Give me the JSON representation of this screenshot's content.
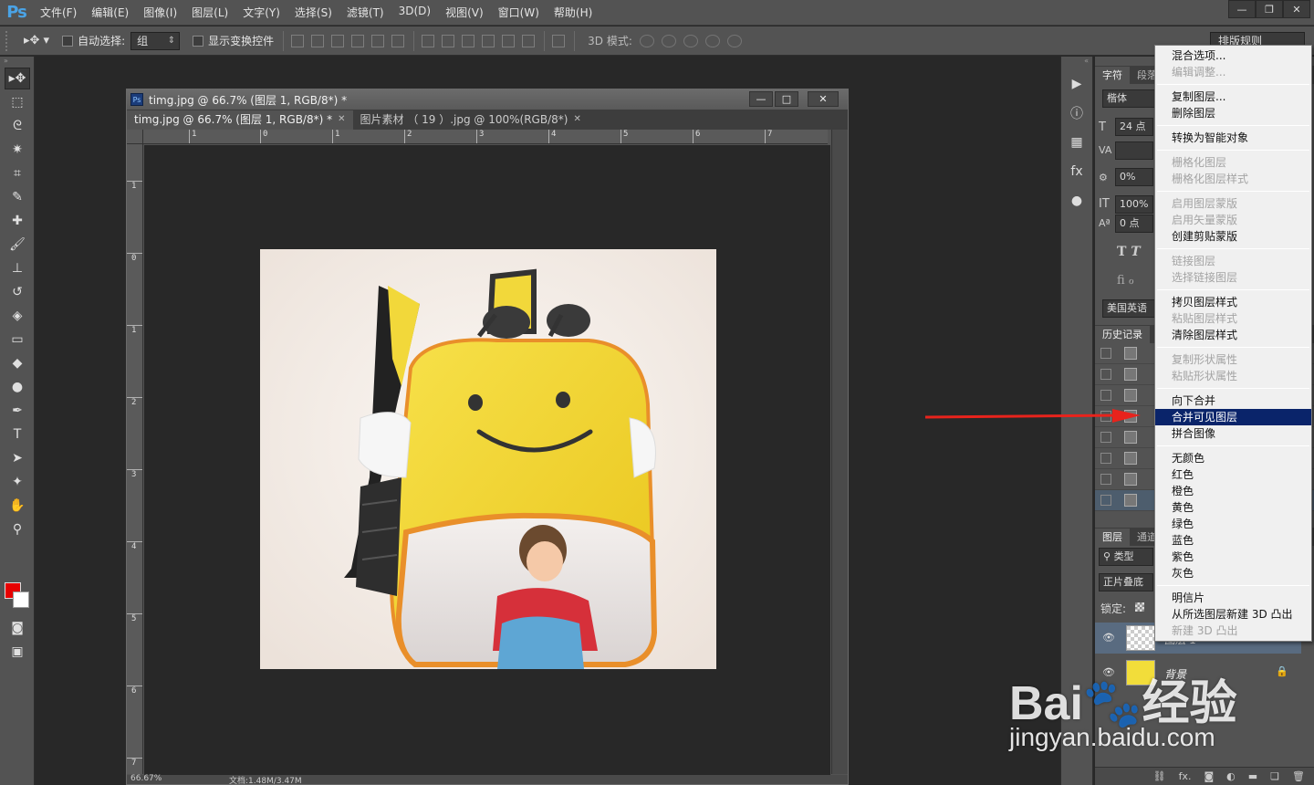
{
  "app": {
    "logo": "Ps",
    "menu": [
      "文件(F)",
      "编辑(E)",
      "图像(I)",
      "图层(L)",
      "文字(Y)",
      "选择(S)",
      "滤镜(T)",
      "3D(D)",
      "视图(V)",
      "窗口(W)",
      "帮助(H)"
    ],
    "window_controls": [
      "—",
      "❐",
      "✕"
    ]
  },
  "options_bar": {
    "auto_select_label": "自动选择:",
    "auto_select_value": "组",
    "show_transform_label": "显示变换控件",
    "mode_3d_label": "3D 模式:",
    "workspace": "排版规则"
  },
  "document": {
    "title": "timg.jpg @ 66.7% (图层 1, RGB/8*) *",
    "tabs": [
      {
        "label": "timg.jpg @ 66.7% (图层 1, RGB/8*) *",
        "close": "✕"
      },
      {
        "label": "图片素材 （ 19 ）.jpg @ 100%(RGB/8*)",
        "close": "✕"
      }
    ],
    "ruler_top": [
      "1",
      "0",
      "1",
      "2",
      "3",
      "4",
      "5",
      "6",
      "7"
    ],
    "ruler_left": [
      "1",
      "0",
      "1",
      "2",
      "3",
      "4",
      "5",
      "6",
      "7"
    ],
    "status_zoom": "66.67%",
    "status_doc": "文档:1.48M/3.47M"
  },
  "right_panel": {
    "char_tabs": [
      "字符",
      "段落"
    ],
    "font_family": "楷体",
    "font_size": "24 点",
    "tracking": "0%",
    "vscale": "100%",
    "baseline": "0 点",
    "language": "美国英语",
    "history_tab": "历史记录",
    "layers_tabs": [
      "图层",
      "通道"
    ],
    "filter_kind": "类型",
    "blend_mode": "正片叠底",
    "lock_label": "锁定:",
    "layers": [
      {
        "name": "图层 1"
      },
      {
        "name": "背景"
      }
    ]
  },
  "context_menu": {
    "groups": [
      [
        {
          "label": "混合选项...",
          "enabled": true
        },
        {
          "label": "编辑调整...",
          "enabled": false
        }
      ],
      [
        {
          "label": "复制图层...",
          "enabled": true
        },
        {
          "label": "删除图层",
          "enabled": true
        }
      ],
      [
        {
          "label": "转换为智能对象",
          "enabled": true
        }
      ],
      [
        {
          "label": "栅格化图层",
          "enabled": false
        },
        {
          "label": "栅格化图层样式",
          "enabled": false
        }
      ],
      [
        {
          "label": "启用图层蒙版",
          "enabled": false
        },
        {
          "label": "启用矢量蒙版",
          "enabled": false
        },
        {
          "label": "创建剪贴蒙版",
          "enabled": true
        }
      ],
      [
        {
          "label": "链接图层",
          "enabled": false
        },
        {
          "label": "选择链接图层",
          "enabled": false
        }
      ],
      [
        {
          "label": "拷贝图层样式",
          "enabled": true
        },
        {
          "label": "粘贴图层样式",
          "enabled": false
        },
        {
          "label": "清除图层样式",
          "enabled": true
        }
      ],
      [
        {
          "label": "复制形状属性",
          "enabled": false
        },
        {
          "label": "粘贴形状属性",
          "enabled": false
        }
      ],
      [
        {
          "label": "向下合并",
          "enabled": true
        },
        {
          "label": "合并可见图层",
          "enabled": true,
          "selected": true
        },
        {
          "label": "拼合图像",
          "enabled": true
        }
      ],
      [
        {
          "label": "无颜色",
          "enabled": true
        },
        {
          "label": "红色",
          "enabled": true
        },
        {
          "label": "橙色",
          "enabled": true
        },
        {
          "label": "黄色",
          "enabled": true
        },
        {
          "label": "绿色",
          "enabled": true
        },
        {
          "label": "蓝色",
          "enabled": true
        },
        {
          "label": "紫色",
          "enabled": true
        },
        {
          "label": "灰色",
          "enabled": true
        }
      ],
      [
        {
          "label": "明信片",
          "enabled": true
        },
        {
          "label": "从所选图层新建 3D 凸出",
          "enabled": true
        },
        {
          "label": "新建 3D 凸出",
          "enabled": false
        }
      ]
    ]
  },
  "watermark": {
    "brand": "Bai🐾经验",
    "url": "jingyan.baidu.com"
  },
  "colors": {
    "foreground": "#e60000",
    "background": "#ffffff",
    "menu_highlight": "#0a246a",
    "annotation_arrow": "#e8231c"
  }
}
